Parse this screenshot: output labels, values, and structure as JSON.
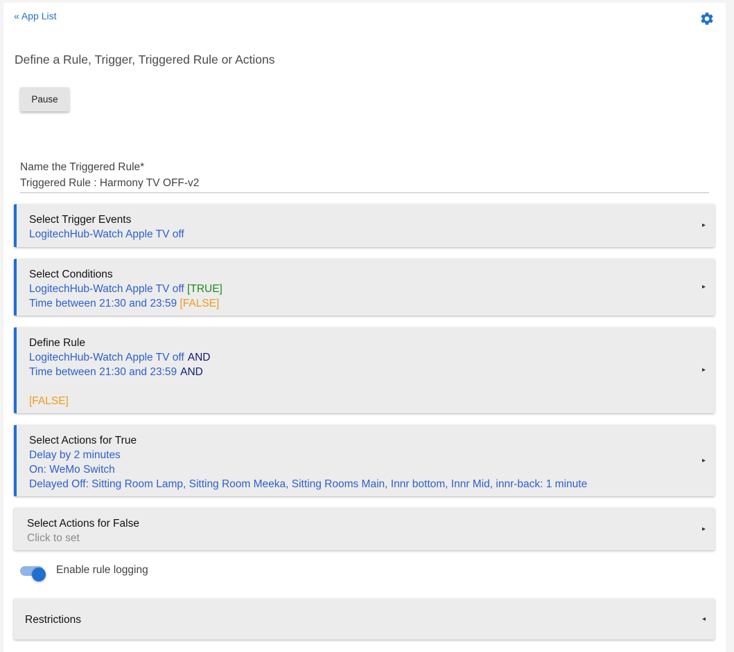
{
  "header": {
    "back_link": "« App List",
    "settings_icon": "gear-icon",
    "accent_color": "#1f6fd1"
  },
  "page": {
    "title": "Define a Rule, Trigger, Triggered Rule or Actions",
    "pause_label": "Pause"
  },
  "name_field": {
    "label": "Name the Triggered Rule*",
    "value": "Triggered Rule : Harmony TV OFF-v2"
  },
  "sections": {
    "trigger_events": {
      "title": "Select Trigger Events",
      "lines": [
        "LogitechHub-Watch Apple TV off"
      ]
    },
    "conditions": {
      "title": "Select Conditions",
      "lines": [
        {
          "text": "LogitechHub-Watch Apple TV off ",
          "status": "[TRUE]"
        },
        {
          "text": "Time between 21:30 and 23:59 ",
          "status": "[FALSE]"
        }
      ]
    },
    "define_rule": {
      "title": "Define Rule",
      "lines": [
        {
          "text": "LogitechHub-Watch Apple TV off",
          "operator": "AND"
        },
        {
          "text": "Time between 21:30 and 23:59",
          "operator": "AND"
        }
      ],
      "result": "[FALSE]"
    },
    "actions_true": {
      "title": "Select Actions for True",
      "lines": [
        "Delay by 2 minutes",
        "On: WeMo Switch",
        "Delayed Off: Sitting Room Lamp, Sitting Room Meeka, Sitting Rooms Main, Innr bottom, Innr Mid, innr-back: 1 minute"
      ]
    },
    "actions_false": {
      "title": "Select Actions for False",
      "placeholder": "Click to set"
    },
    "restrictions": {
      "title": "Restrictions"
    }
  },
  "logging": {
    "label": "Enable rule logging",
    "enabled": true
  },
  "icons": {
    "expand": "▸",
    "collapse": "◂"
  },
  "colors": {
    "link": "#2e5fcc",
    "true": "#1e8a1e",
    "false": "#f09a1c",
    "operator": "#101a7a"
  }
}
